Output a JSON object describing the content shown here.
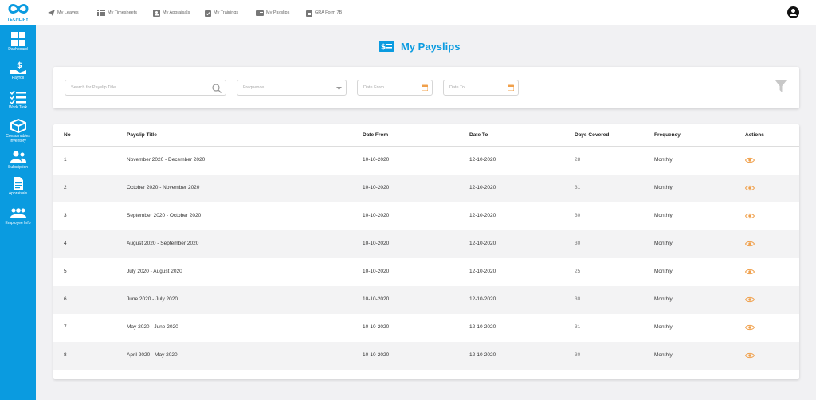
{
  "brand": {
    "name": "TECHLIFY",
    "accent": "#0a9be0",
    "icon": "infinity-logo-icon"
  },
  "sidebar": {
    "items": [
      {
        "label": "Dashboard",
        "icon": "dashboard-icon"
      },
      {
        "label": "Payroll",
        "icon": "payroll-icon"
      },
      {
        "label": "Work Task",
        "icon": "task-list-icon"
      },
      {
        "label": "Consumables Inventory",
        "icon": "box-icon"
      },
      {
        "label": "Subcription",
        "icon": "users-icon"
      },
      {
        "label": "Appraisals",
        "icon": "document-icon"
      },
      {
        "label": "Employee Info",
        "icon": "group-icon"
      }
    ]
  },
  "topbar": {
    "items": [
      {
        "label": "My Leaves",
        "icon": "send-icon"
      },
      {
        "label": "My Timesheets",
        "icon": "list-icon"
      },
      {
        "label": "My Appraisals",
        "icon": "id-card-icon"
      },
      {
        "label": "My Trainings",
        "icon": "clipboard-check-icon"
      },
      {
        "label": "My Payslips",
        "icon": "payslip-icon"
      },
      {
        "label": "GRA Form 7B",
        "icon": "form-icon"
      }
    ],
    "user_icon": "user-account-icon"
  },
  "page": {
    "title": "My Payslips",
    "title_icon": "payslip-icon"
  },
  "filters": {
    "search_placeholder": "Search for Payslip Title",
    "frequency_placeholder": "Frequence",
    "date_from_placeholder": "Date From",
    "date_to_placeholder": "Date To",
    "filter_icon": "funnel-icon"
  },
  "table": {
    "headers": [
      "No",
      "Payslip Title",
      "Date From",
      "Date To",
      "Days Covered",
      "Frequency",
      "Actions"
    ],
    "rows": [
      {
        "no": "1",
        "title": "November 2020 - December 2020",
        "from": "10-10-2020",
        "to": "12-10-2020",
        "days": "28",
        "freq": "Monthly"
      },
      {
        "no": "2",
        "title": "October 2020 - November 2020",
        "from": "10-10-2020",
        "to": "12-10-2020",
        "days": "31",
        "freq": "Monthly"
      },
      {
        "no": "3",
        "title": "September 2020 - October 2020",
        "from": "10-10-2020",
        "to": "12-10-2020",
        "days": "30",
        "freq": "Monthly"
      },
      {
        "no": "4",
        "title": "August 2020 - September 2020",
        "from": "10-10-2020",
        "to": "12-10-2020",
        "days": "30",
        "freq": "Monthly"
      },
      {
        "no": "5",
        "title": "July 2020 - August 2020",
        "from": "10-10-2020",
        "to": "12-10-2020",
        "days": "25",
        "freq": "Monthly"
      },
      {
        "no": "6",
        "title": "June 2020 - July 2020",
        "from": "10-10-2020",
        "to": "12-10-2020",
        "days": "30",
        "freq": "Monthly"
      },
      {
        "no": "7",
        "title": "May 2020 - June 2020",
        "from": "10-10-2020",
        "to": "12-10-2020",
        "days": "31",
        "freq": "Monthly"
      },
      {
        "no": "8",
        "title": "April 2020 - May 2020",
        "from": "10-10-2020",
        "to": "12-10-2020",
        "days": "30",
        "freq": "Monthly"
      }
    ],
    "action_icon": "eye-icon",
    "action_color": "#f0a04b"
  }
}
